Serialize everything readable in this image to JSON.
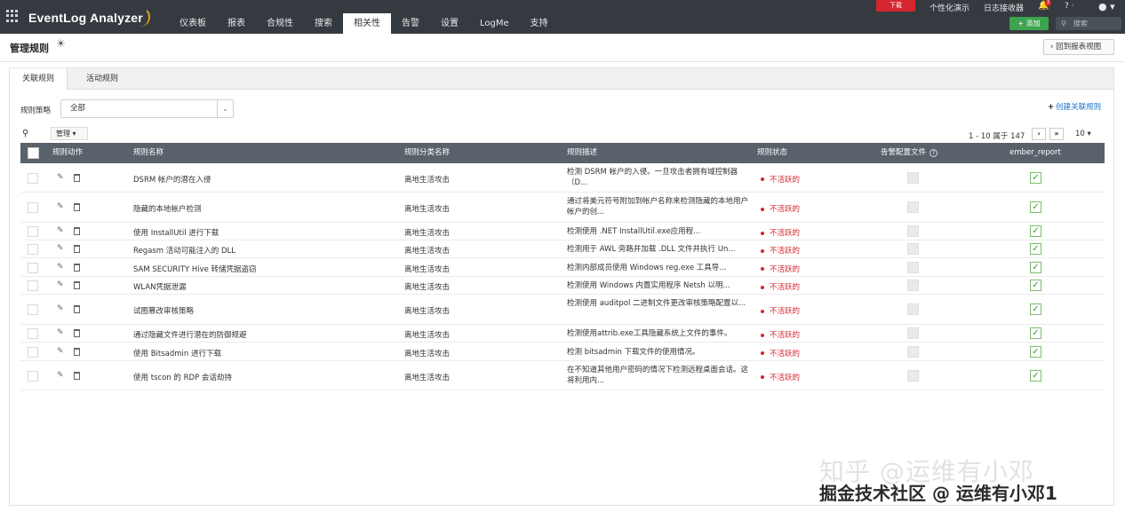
{
  "app": {
    "brand": "EventLog Analyzer",
    "nav": [
      "仪表板",
      "报表",
      "合规性",
      "搜索",
      "相关性",
      "告警",
      "设置",
      "LogMe",
      "支持"
    ],
    "active_nav": "相关性",
    "download_label": "下载",
    "personalize_label": "个性化演示",
    "log_receiver_label": "日志接收器",
    "notification_count": "3",
    "help_label": "? ·",
    "add_label": "+ 添加",
    "search_placeholder": "搜索"
  },
  "page": {
    "title": "管理规则",
    "back_label": "回到报表视图"
  },
  "tabs": [
    "关联规则",
    "活动规则"
  ],
  "filter": {
    "label": "规则策略",
    "value": "全部",
    "create_label": "创建关联规则"
  },
  "toolbar": {
    "manage_label": "管理 ▾",
    "pager_text": "1 - 10 属于 147",
    "per_page": "10 ▾"
  },
  "table": {
    "headers": [
      "规则动作",
      "规则名称",
      "规则分类名称",
      "规则描述",
      "规则状态",
      "告警配置文件",
      "ember_report"
    ],
    "rows": [
      {
        "name": "DSRM 帐户的潜在入侵",
        "category": "离地生活攻击",
        "desc": "检测 DSRM 帐户的入侵。一旦攻击者拥有域控制器 （D...",
        "status": "不活跃的"
      },
      {
        "name": "隐藏的本地帐户检测",
        "category": "离地生活攻击",
        "desc": "通过将美元符号附加到帐户名称来检测隐藏的本地用户帐户的创...",
        "status": "不活跃的"
      },
      {
        "name": "使用 InstallUtil 进行下载",
        "category": "离地生活攻击",
        "desc": "检测使用 .NET InstallUtil.exe应用程...",
        "status": "不活跃的"
      },
      {
        "name": "Regasm 活动可能注入的 DLL",
        "category": "离地生活攻击",
        "desc": "检测用于 AWL 旁路并加载 .DLL 文件并执行 Un...",
        "status": "不活跃的"
      },
      {
        "name": "SAM SECURITY Hive 转储凭据盗窃",
        "category": "离地生活攻击",
        "desc": "检测内部成员使用 Windows reg.exe 工具导...",
        "status": "不活跃的"
      },
      {
        "name": "WLAN凭据泄漏",
        "category": "离地生活攻击",
        "desc": "检测使用 Windows 内置实用程序 Netsh 以明...",
        "status": "不活跃的"
      },
      {
        "name": "试图篡改审核策略",
        "category": "离地生活攻击",
        "desc": "检测使用 auditpol 二进制文件更改审核策略配置以...",
        "status": "不活跃的"
      },
      {
        "name": "通过隐藏文件进行潜在的防御规避",
        "category": "离地生活攻击",
        "desc": "检测使用attrib.exe工具隐藏系统上文件的事件。",
        "status": "不活跃的"
      },
      {
        "name": "使用 Bitsadmin 进行下载",
        "category": "离地生活攻击",
        "desc": "检测 bitsadmin 下载文件的使用情况。",
        "status": "不活跃的"
      },
      {
        "name": "使用 tscon 的 RDP 会话劫持",
        "category": "离地生活攻击",
        "desc": "在不知道其他用户密码的情况下检测远程桌面会话。这将利用内...",
        "status": "不活跃的"
      }
    ]
  },
  "watermark": {
    "line1": "知乎 @运维有小邓",
    "line2": "掘金技术社区 @ 运维有小邓1"
  },
  "colors": {
    "topbar": "#353a40",
    "table_header": "#59616b",
    "inactive_status": "#d4262e",
    "add_button": "#3ea34f",
    "download_button": "#d4262e",
    "link": "#1b6fc2"
  }
}
